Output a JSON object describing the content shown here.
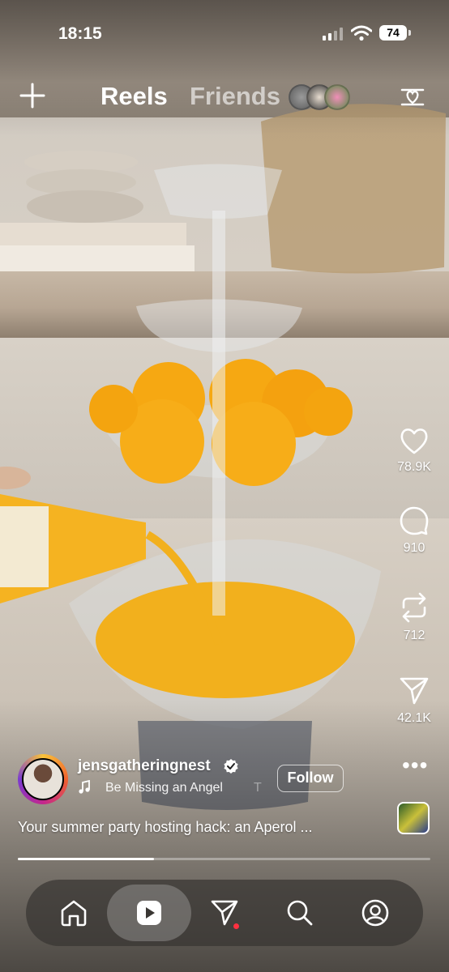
{
  "status_bar": {
    "time": "18:15",
    "battery": "74"
  },
  "header": {
    "tabs": [
      {
        "label": "Reels",
        "active": true
      },
      {
        "label": "Friends",
        "active": false
      }
    ]
  },
  "actions": {
    "likes": "78.9K",
    "comments": "910",
    "reposts": "712",
    "shares": "42.1K"
  },
  "creator": {
    "username": "jensgatheringnest",
    "verified": true,
    "song": "Be Missing an Angel",
    "song_extra": "T",
    "follow_label": "Follow"
  },
  "caption": "Your summer party hosting hack: an Aperol ...",
  "progress": 0.33,
  "nav": {
    "items": [
      {
        "icon": "home-icon"
      },
      {
        "icon": "reels-icon",
        "active": true
      },
      {
        "icon": "direct-send-icon",
        "notification": true
      },
      {
        "icon": "search-icon"
      },
      {
        "icon": "profile-icon"
      }
    ]
  },
  "colors": {
    "accent_dot": "#ff3040",
    "text": "#ffffff"
  }
}
